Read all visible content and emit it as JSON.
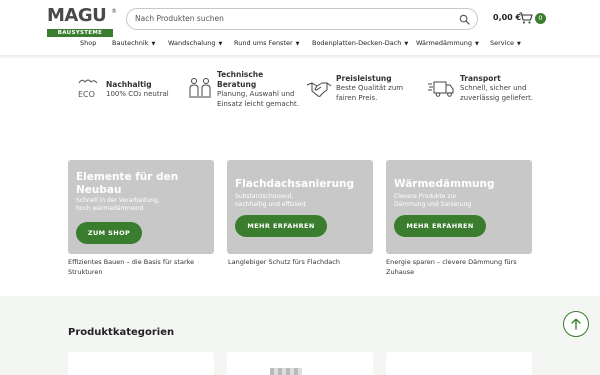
{
  "header": {
    "logo_main": "MAGU",
    "logo_reg": "®",
    "logo_sub": "BAUSYSTEME",
    "search_placeholder": "Nach Produkten suchen",
    "cart_total": "0,00 €",
    "cart_count": "0"
  },
  "nav": {
    "items": [
      {
        "label": "Shop",
        "has_dropdown": false
      },
      {
        "label": "Bautechnik",
        "has_dropdown": true
      },
      {
        "label": "Wandschalung",
        "has_dropdown": true
      },
      {
        "label": "Rund ums Fenster",
        "has_dropdown": true
      },
      {
        "label": "Bodenplatten-Decken-Dach",
        "has_dropdown": true
      },
      {
        "label": "Wärmedämmung",
        "has_dropdown": true
      },
      {
        "label": "Service",
        "has_dropdown": true
      }
    ]
  },
  "usps": [
    {
      "icon": "eco-icon",
      "icon_text": "ECO",
      "title": "Nachhaltig",
      "lines": [
        "100% CO₂ neutral"
      ]
    },
    {
      "icon": "team-icon",
      "title_lines": [
        "Technische",
        "Beratung"
      ],
      "lines": [
        "Planung, Auswahl und",
        "Einsatz leicht gemacht."
      ]
    },
    {
      "icon": "handshake-icon",
      "title": "Preisleistung",
      "lines": [
        "Beste Qualität zum",
        "fairen Preis."
      ]
    },
    {
      "icon": "truck-icon",
      "title": "Transport",
      "lines": [
        "Schnell, sicher und",
        "zuverlässig geliefert."
      ]
    }
  ],
  "cards": [
    {
      "title_lines": [
        "Elemente für den",
        "Neubau"
      ],
      "sub_lines": [
        "Schnell in der Verarbeitung,",
        "hoch wärmedämmend"
      ],
      "button": "ZUM SHOP",
      "caption_lines": [
        "Effizientes Bauen – die Basis für starke",
        "Strukturen"
      ]
    },
    {
      "title_lines": [
        "Flachdachsanierung"
      ],
      "sub_lines": [
        "Substanzschonend,",
        "nachhaltig und effizient"
      ],
      "button": "MEHR ERFAHREN",
      "caption_lines": [
        "Langlebiger Schutz fürs Flachdach"
      ]
    },
    {
      "title_lines": [
        "Wärmedämmung"
      ],
      "sub_lines": [
        "Clevere Produkte zur",
        "Dämmung und Sanierung"
      ],
      "button": "MEHR ERFAHREN",
      "caption_lines": [
        "Energie sparen – clevere Dämmung fürs",
        "Zuhause"
      ]
    }
  ],
  "section": {
    "title": "Produktkategorien"
  },
  "colors": {
    "brand_green": "#3b7d2f",
    "card_gray": "#c8c8c8",
    "logo_gray": "#4a4a4a"
  }
}
